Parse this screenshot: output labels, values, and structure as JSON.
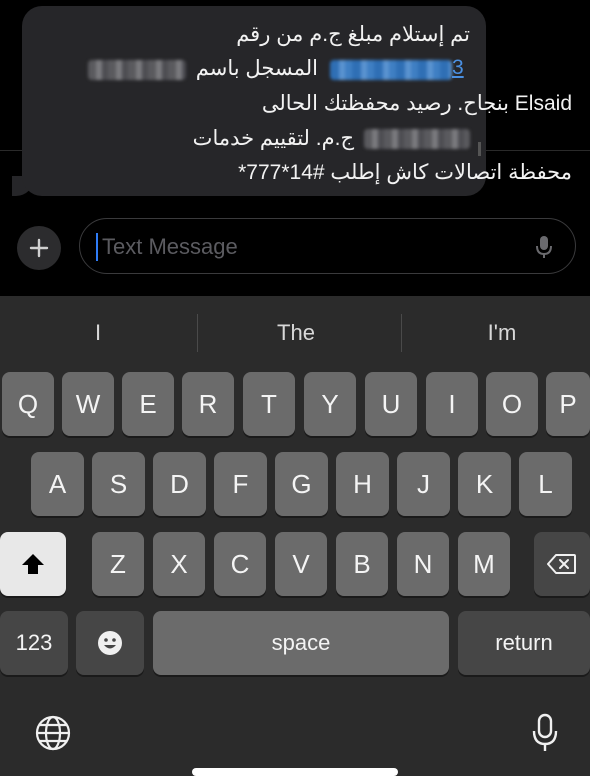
{
  "message": {
    "line1": "تم إستلام مبلغ          ج.م من رقم",
    "line2_link_end": "3",
    "line2_text": "المسجل باسم",
    "line3": "Elsaid    بنجاح. رصيد محفظتك الحالى",
    "line4": "ج.م. لتقييم خدمات",
    "line5": "محفظة اتصالات  كاش إطلب #14*777*"
  },
  "composer": {
    "placeholder": "Text Message",
    "plus_icon": "plus-icon",
    "mic_icon": "microphone-icon"
  },
  "suggestions": [
    "I",
    "The",
    "I'm"
  ],
  "keyboard": {
    "row1": [
      "Q",
      "W",
      "E",
      "R",
      "T",
      "Y",
      "U",
      "I",
      "O",
      "P"
    ],
    "row2": [
      "A",
      "S",
      "D",
      "F",
      "G",
      "H",
      "J",
      "K",
      "L"
    ],
    "row3": [
      "Z",
      "X",
      "C",
      "V",
      "B",
      "N",
      "M"
    ],
    "numbers_label": "123",
    "space_label": "space",
    "return_label": "return",
    "shift_icon": "shift-icon",
    "delete_icon": "backspace-icon",
    "emoji_icon": "emoji-icon",
    "globe_icon": "globe-icon",
    "dictation_icon": "microphone-icon"
  }
}
